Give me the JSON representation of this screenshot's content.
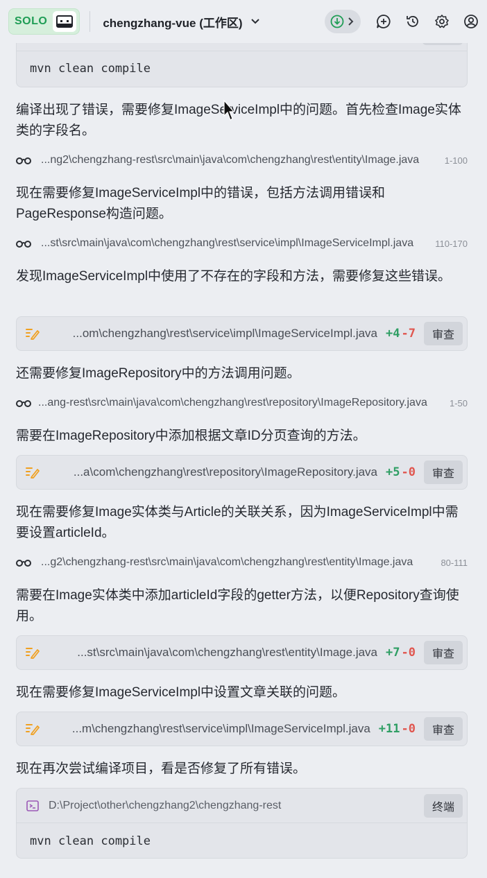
{
  "header": {
    "badge": "SOLO",
    "workspace": "chengzhang-vue (工作区)"
  },
  "top_code": {
    "command": "mvn clean compile"
  },
  "messages": [
    "编译出现了错误，需要修复ImageServiceImpl中的问题。首先检查Image实体类的字段名。",
    "现在需要修复ImageServiceImpl中的错误，包括方法调用错误和PageResponse构造问题。",
    "发现ImageServiceImpl中使用了不存在的字段和方法，需要修复这些错误。",
    "还需要修复ImageRepository中的方法调用问题。",
    "需要在ImageRepository中添加根据文章ID分页查询的方法。",
    "现在需要修复Image实体类与Article的关联关系，因为ImageServiceImpl中需要设置articleId。",
    "需要在Image实体类中添加articleId字段的getter方法，以便Repository查询使用。",
    "现在需要修复ImageServiceImpl中设置文章关联的问题。",
    "现在再次尝试编译项目，看是否修复了所有错误。"
  ],
  "reads": [
    {
      "path": "...ng2\\chengzhang-rest\\src\\main\\java\\com\\chengzhang\\rest\\entity\\Image.java",
      "range": "1-100"
    },
    {
      "path": "...st\\src\\main\\java\\com\\chengzhang\\rest\\service\\impl\\ImageServiceImpl.java",
      "range": "110-170"
    },
    {
      "path": "...ang-rest\\src\\main\\java\\com\\chengzhang\\rest\\repository\\ImageRepository.java",
      "range": "1-50"
    },
    {
      "path": "...g2\\chengzhang-rest\\src\\main\\java\\com\\chengzhang\\rest\\entity\\Image.java",
      "range": "80-111"
    }
  ],
  "edits": [
    {
      "path": "...om\\chengzhang\\rest\\service\\impl\\ImageServiceImpl.java",
      "plus": "+4",
      "minus": "-7",
      "button": "审查"
    },
    {
      "path": "...a\\com\\chengzhang\\rest\\repository\\ImageRepository.java",
      "plus": "+5",
      "minus": "-0",
      "button": "审查"
    },
    {
      "path": "...st\\src\\main\\java\\com\\chengzhang\\rest\\entity\\Image.java",
      "plus": "+7",
      "minus": "-0",
      "button": "审查"
    },
    {
      "path": "...m\\chengzhang\\rest\\service\\impl\\ImageServiceImpl.java",
      "plus": "+11",
      "minus": "-0",
      "button": "审查"
    }
  ],
  "terminal": {
    "path": "D:\\Project\\other\\chengzhang2\\chengzhang-rest",
    "button": "终端",
    "command": "mvn clean compile"
  },
  "colors": {
    "accent_green": "#1f9d55",
    "plus": "#2f9e64",
    "minus": "#e0564f",
    "edit_icon": "#f0a020",
    "terminal_icon": "#9b59b6"
  }
}
